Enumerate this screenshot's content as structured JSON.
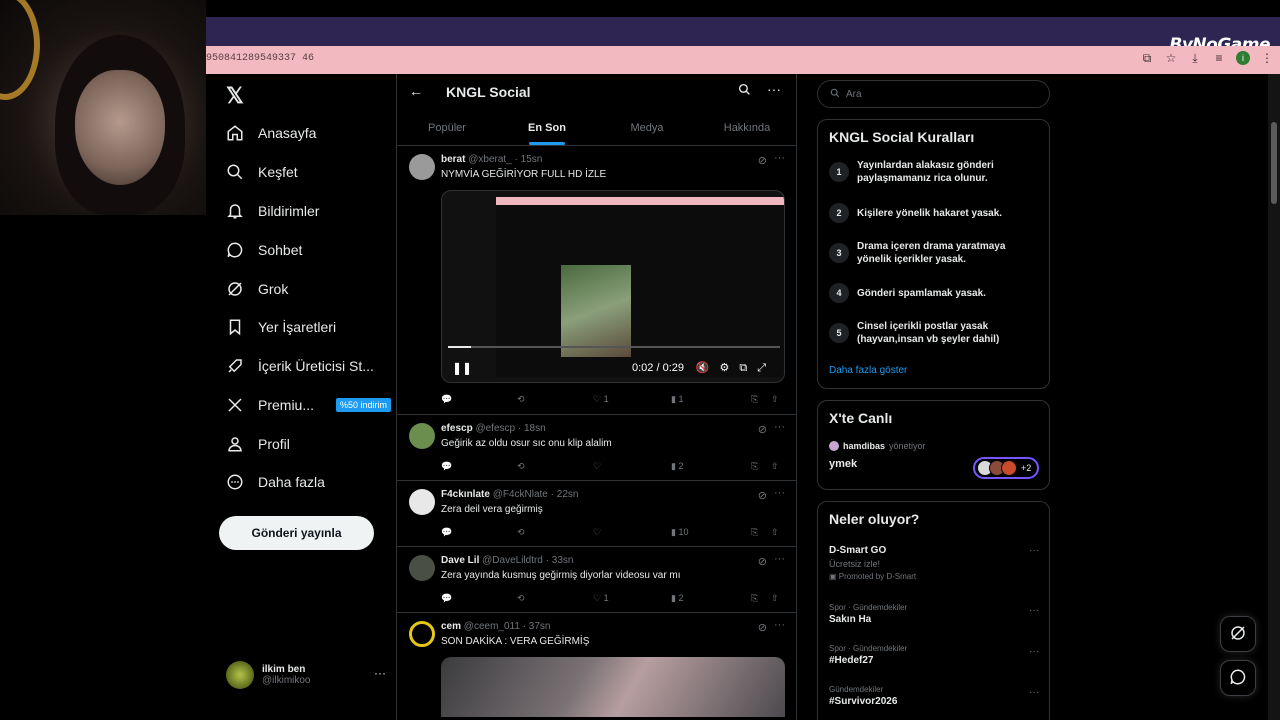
{
  "browser": {
    "url": "950841289549337 46",
    "watermark": "ByNoGame"
  },
  "nav": {
    "items": [
      {
        "label": "Anasayfa",
        "icon": "home-icon"
      },
      {
        "label": "Keşfet",
        "icon": "search-icon"
      },
      {
        "label": "Bildirimler",
        "icon": "bell-icon"
      },
      {
        "label": "Sohbet",
        "icon": "chat-icon"
      },
      {
        "label": "Grok",
        "icon": "grok-icon"
      },
      {
        "label": "Yer İşaretleri",
        "icon": "bookmark-icon"
      },
      {
        "label": "İçerik Üreticisi St...",
        "icon": "rocket-icon"
      },
      {
        "label": "Premiu...",
        "icon": "x-icon"
      },
      {
        "label": "Profil",
        "icon": "person-icon"
      },
      {
        "label": "Daha fazla",
        "icon": "more-circle-icon"
      }
    ],
    "premium_badge": "%50 indirim",
    "post_button": "Gönderi yayınla",
    "account": {
      "name": "ilkim ben",
      "handle": "@ilkimikoo"
    }
  },
  "community": {
    "title": "KNGL Social",
    "tabs": [
      "Popüler",
      "En Son",
      "Medya",
      "Hakkında"
    ],
    "active_tab": "En Son"
  },
  "posts": [
    {
      "name": "berat",
      "handle": "@xberat_",
      "time": "· 15sn",
      "text": "NYMVİA GEĞİRİYOR FULL HD İZLE",
      "likes": "1",
      "views": "1",
      "video_time": "0:02 / 0:29",
      "video_progress": 0.07,
      "avatar_color": "#9a9a9a"
    },
    {
      "name": "efescp",
      "handle": "@efescp",
      "time": "· 18sn",
      "text": "Geğirik az oldu osur sıc onu klip alalim",
      "likes": "",
      "views": "2",
      "avatar_color": "#6b8e4e"
    },
    {
      "name": "F4ckınlate",
      "handle": "@F4ckNlate",
      "time": "· 22sn",
      "text": "Zera deil vera geğirmiş",
      "likes": "",
      "views": "10",
      "avatar_color": "#e8e8e8"
    },
    {
      "name": "Dave Lil",
      "handle": "@DaveLildtrd",
      "time": "· 33sn",
      "text": "Zera yayında kusmuş geğirmiş diyorlar videosu var mı",
      "likes": "1",
      "views": "2",
      "avatar_color": "#4a4f44"
    },
    {
      "name": "cem",
      "handle": "@ceem_011",
      "time": "· 37sn",
      "text": "SON DAKİKA : VERA GEĞİRMİŞ",
      "avatar_color": "#e6c619"
    }
  ],
  "right": {
    "search_placeholder": "Ara",
    "rules": {
      "title": "KNGL Social Kuralları",
      "items": [
        {
          "num": "1",
          "text": "Yayınlardan alakasız gönderi paylaşmamanız rica olunur."
        },
        {
          "num": "2",
          "text": "Kişilere yönelik hakaret yasak."
        },
        {
          "num": "3",
          "text": "Drama içeren drama yaratmaya yönelik içerikler yasak."
        },
        {
          "num": "4",
          "text": "Gönderi spamlamak yasak."
        },
        {
          "num": "5",
          "text": "Cinsel içerikli postlar yasak (hayvan,insan vb şeyler dahil)"
        }
      ],
      "more": "Daha fazla göster"
    },
    "live": {
      "title": "X'te Canlı",
      "host": "hamdibas",
      "host_role": "yönetiyor",
      "space_title": "ymek",
      "extra": "+2"
    },
    "trends": {
      "title": "Neler oluyor?",
      "items": [
        {
          "name": "D-Smart GO",
          "sub": "Ücretsiz izle!",
          "promo": "Promoted by D-Smart"
        },
        {
          "cat": "Spor · Gündemdekiler",
          "name": "Sakın Ha"
        },
        {
          "cat": "Spor · Gündemdekiler",
          "name": "#Hedef27"
        },
        {
          "cat": "Gündemdekiler",
          "name": "#Survivor2026"
        }
      ]
    }
  }
}
